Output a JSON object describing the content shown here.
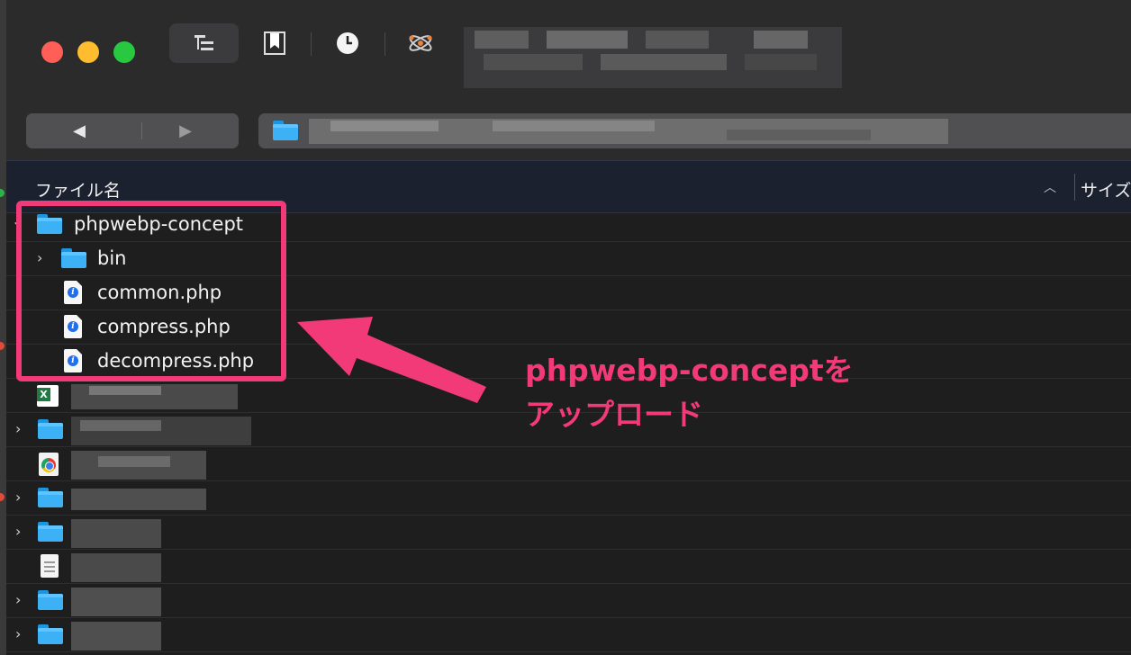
{
  "column_header": {
    "name": "ファイル名",
    "size": "サイズ",
    "sort_icon": "chevron-up-icon"
  },
  "tree": {
    "root": {
      "label": "phpwebp-concept",
      "icon": "folder-icon",
      "expanded": true
    },
    "children": [
      {
        "label": "bin",
        "icon": "folder-icon",
        "collapsed": true
      },
      {
        "label": "common.php",
        "icon": "php-file-icon"
      },
      {
        "label": "compress.php",
        "icon": "php-file-icon"
      },
      {
        "label": "decompress.php",
        "icon": "php-file-icon"
      }
    ],
    "obscured_rows": [
      {
        "icon": "excel-file-icon"
      },
      {
        "icon": "folder-icon"
      },
      {
        "icon": "chrome-file-icon"
      },
      {
        "icon": "folder-icon"
      },
      {
        "icon": "folder-icon"
      },
      {
        "icon": "text-file-icon"
      },
      {
        "icon": "folder-icon"
      },
      {
        "icon": "folder-icon"
      }
    ]
  },
  "annotation": {
    "line1": "phpwebp-conceptを",
    "line2": "アップロード"
  },
  "colors": {
    "accent": "#f33a78",
    "folder": "#3cb1f5",
    "close": "#ff5f57",
    "minimize": "#febc2e",
    "zoom": "#28c840"
  }
}
